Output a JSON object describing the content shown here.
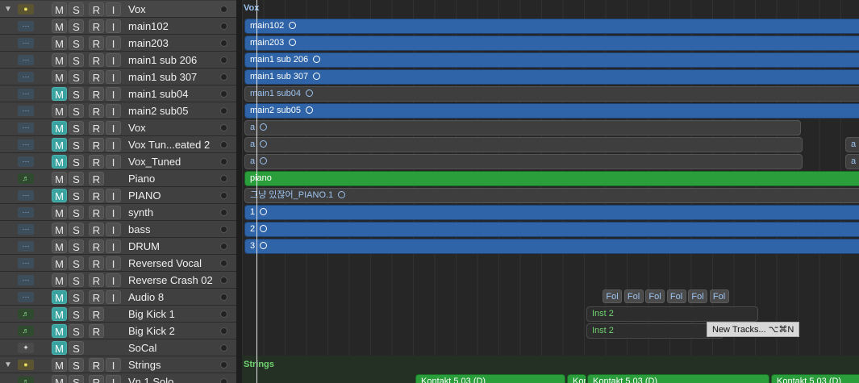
{
  "tracks": [
    {
      "name": "Vox",
      "icon": "folder-icon",
      "type": "fold",
      "disc": "▼",
      "mute_on": false,
      "has_i": true,
      "sel": true
    },
    {
      "name": "main102",
      "icon": "waveform-icon",
      "type": "audio",
      "disc": "",
      "mute_on": false,
      "has_i": true
    },
    {
      "name": "main203",
      "icon": "waveform-icon",
      "type": "audio",
      "disc": "",
      "mute_on": false,
      "has_i": true
    },
    {
      "name": "main1 sub 206",
      "icon": "waveform-icon",
      "type": "audio",
      "disc": "",
      "mute_on": false,
      "has_i": true
    },
    {
      "name": "main1 sub 307",
      "icon": "waveform-icon",
      "type": "audio",
      "disc": "",
      "mute_on": false,
      "has_i": true
    },
    {
      "name": "main1 sub04",
      "icon": "waveform-icon",
      "type": "audio",
      "disc": "",
      "mute_on": true,
      "has_i": true
    },
    {
      "name": "main2 sub05",
      "icon": "waveform-icon",
      "type": "audio",
      "disc": "",
      "mute_on": false,
      "has_i": true
    },
    {
      "name": "Vox",
      "icon": "waveform-icon",
      "type": "audio",
      "disc": "",
      "mute_on": true,
      "has_i": true
    },
    {
      "name": "Vox Tun...eated 2",
      "icon": "waveform-icon",
      "type": "audio",
      "disc": "",
      "mute_on": true,
      "has_i": true
    },
    {
      "name": "Vox_Tuned",
      "icon": "waveform-icon",
      "type": "audio",
      "disc": "",
      "mute_on": true,
      "has_i": true
    },
    {
      "name": "Piano",
      "icon": "instrument-icon",
      "type": "inst",
      "disc": "",
      "mute_on": false,
      "has_i": false
    },
    {
      "name": "PIANO",
      "icon": "waveform-icon",
      "type": "audio",
      "disc": "",
      "mute_on": true,
      "has_i": true
    },
    {
      "name": "synth",
      "icon": "waveform-icon",
      "type": "audio",
      "disc": "",
      "mute_on": false,
      "has_i": true
    },
    {
      "name": "bass",
      "icon": "waveform-icon",
      "type": "audio",
      "disc": "",
      "mute_on": false,
      "has_i": true
    },
    {
      "name": "DRUM",
      "icon": "waveform-icon",
      "type": "audio",
      "disc": "",
      "mute_on": false,
      "has_i": true
    },
    {
      "name": "Reversed Vocal",
      "icon": "waveform-icon",
      "type": "audio",
      "disc": "",
      "mute_on": false,
      "has_i": true
    },
    {
      "name": "Reverse Crash 02",
      "icon": "waveform-icon",
      "type": "audio",
      "disc": "",
      "mute_on": false,
      "has_i": true
    },
    {
      "name": "Audio 8",
      "icon": "waveform-icon",
      "type": "audio",
      "disc": "",
      "mute_on": true,
      "has_i": true
    },
    {
      "name": "Big Kick 1",
      "icon": "instrument-icon",
      "type": "inst",
      "disc": "",
      "mute_on": true,
      "has_i": false
    },
    {
      "name": "Big Kick 2",
      "icon": "instrument-icon",
      "type": "inst",
      "disc": "",
      "mute_on": true,
      "has_i": false
    },
    {
      "name": "SoCal",
      "icon": "drummer-icon",
      "type": "drum",
      "disc": "",
      "mute_on": true,
      "has_i": false,
      "no_r": true
    },
    {
      "name": "Strings",
      "icon": "folder-icon",
      "type": "fold",
      "disc": "▼",
      "mute_on": false,
      "has_i": true
    },
    {
      "name": "Vn 1 Solo",
      "icon": "instrument-icon",
      "type": "inst",
      "disc": "",
      "mute_on": false,
      "has_i": true
    }
  ],
  "labels": {
    "m": "M",
    "s": "S",
    "r": "R",
    "i": "I"
  },
  "icon_glyphs": {
    "fold": "●",
    "audio": "⋯",
    "inst": "♬",
    "drum": "✦"
  },
  "folders": {
    "vox": "Vox",
    "strings": "Strings"
  },
  "regions": [
    {
      "row": 1,
      "label": "main102",
      "style": "blue",
      "ring": true
    },
    {
      "row": 2,
      "label": "main203",
      "style": "blue",
      "ring": true
    },
    {
      "row": 3,
      "label": "main1 sub 206",
      "style": "blue",
      "ring": true
    },
    {
      "row": 4,
      "label": "main1 sub 307",
      "style": "blue",
      "ring": true
    },
    {
      "row": 5,
      "label": "main1 sub04",
      "style": "grey",
      "ring": true
    },
    {
      "row": 6,
      "label": "main2 sub05",
      "style": "blue",
      "ring": true
    },
    {
      "row": 7,
      "label": "a",
      "style": "grey",
      "ring": true
    },
    {
      "row": 8,
      "label": "a",
      "style": "grey",
      "ring": true
    },
    {
      "row": 8,
      "label": "a",
      "style": "grey",
      "ring": false
    },
    {
      "row": 9,
      "label": "a",
      "style": "grey",
      "ring": true
    },
    {
      "row": 9,
      "label": "a",
      "style": "grey",
      "ring": false
    },
    {
      "row": 10,
      "label": "piano",
      "style": "green",
      "ring": false
    },
    {
      "row": 11,
      "label": "그냥 있잖어_PIANO.1",
      "style": "grey",
      "ring": true
    },
    {
      "row": 12,
      "label": "1",
      "style": "blue",
      "ring": true
    },
    {
      "row": 13,
      "label": "2",
      "style": "blue",
      "ring": true
    },
    {
      "row": 14,
      "label": "3",
      "style": "blue",
      "ring": true
    },
    {
      "row": 18,
      "label": "Inst 2",
      "style": "darkgreen",
      "ring": false
    },
    {
      "row": 19,
      "label": "Inst 2",
      "style": "darkgreen",
      "ring": false
    },
    {
      "row": 22,
      "label": "Kontakt 5.03 (D)",
      "style": "green",
      "ring": false
    },
    {
      "row": 22,
      "label": "Kont",
      "style": "green",
      "ring": false
    },
    {
      "row": 22,
      "label": "Kontakt 5.03 (D)",
      "style": "green",
      "ring": false
    },
    {
      "row": 22,
      "label": "Kontakt 5.03 (D)",
      "style": "green",
      "ring": false
    }
  ],
  "folder_buttons": [
    "Fol",
    "Fol",
    "Fol",
    "Fol",
    "Fol",
    "Fol"
  ],
  "tooltip": "New Tracks...   ⌥⌘N"
}
